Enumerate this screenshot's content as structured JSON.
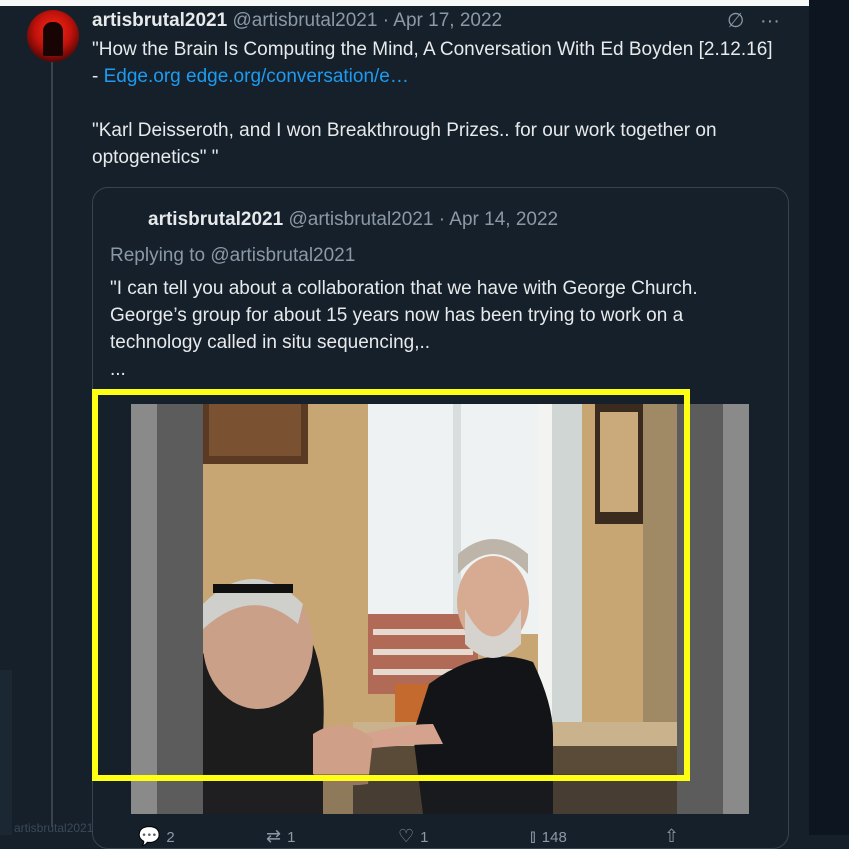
{
  "tweet": {
    "display_name": "artisbrutal2021",
    "handle": "@artisbrutal2021",
    "date": "· Apr 17, 2022",
    "grok_icon": "slash-circle-icon",
    "more_icon": "more-dots-icon",
    "more_glyph": "···",
    "text_line1": "\"How the Brain Is Computing the Mind, A Conversation With Ed Boyden [2.12.16] - ",
    "link1": "Edge.org",
    "link2": "edge.org/conversation/e…",
    "text_para2": "\"Karl Deisseroth, and I won Breakthrough Prizes.. for our work together on optogenetics\" \""
  },
  "quote": {
    "display_name": "artisbrutal2021",
    "handle": "@artisbrutal2021",
    "date": "· Apr 14, 2022",
    "replying_to": "Replying to @artisbrutal2021",
    "text": "\"I can tell you about a collaboration that we have with George Church. George’s group for about 15 years now has been trying to work on a technology called in situ sequencing,..",
    "ellipsis": "..."
  },
  "actions": {
    "reply_count": "2",
    "retweet_count": "1",
    "like_count": "1",
    "views_count": "148"
  },
  "ghost_text": "artisbrutal2021",
  "colors": {
    "background": "#15202b",
    "accent": "#1d9bf0",
    "highlight": "#ffff14"
  }
}
